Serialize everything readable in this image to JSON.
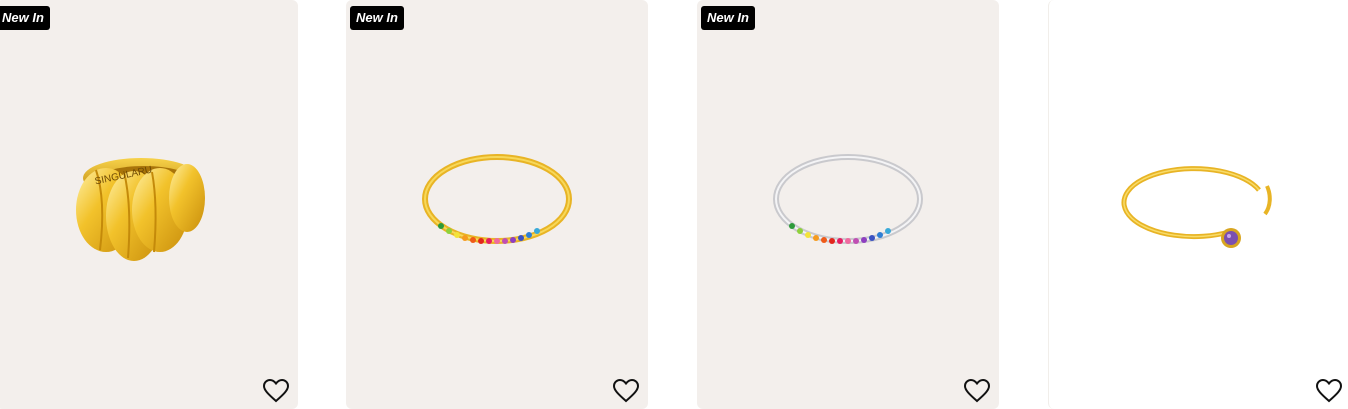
{
  "products": [
    {
      "badge": "New In",
      "image": "chunky-gold-ring",
      "engraving": "SINGULARU",
      "favorite_icon": "heart-outline-icon"
    },
    {
      "badge": "New In",
      "image": "gold-rainbow-eternity-ring",
      "favorite_icon": "heart-outline-icon"
    },
    {
      "badge": "New In",
      "image": "silver-rainbow-eternity-ring",
      "favorite_icon": "heart-outline-icon"
    },
    {
      "badge": "",
      "image": "gold-open-ring-purple-stone",
      "favorite_icon": "heart-outline-icon"
    }
  ],
  "colors": {
    "card_background": "#f3efec",
    "badge_background": "#000000",
    "gold": "#e8b425",
    "silver": "#d9d9dc"
  }
}
